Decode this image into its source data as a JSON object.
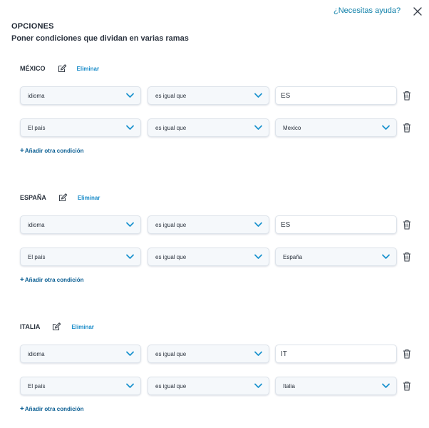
{
  "header": {
    "help_link": "¿Necesitas ayuda?",
    "title": "OPCIONES",
    "subtitle": "Poner condiciones que dividan en varias ramas"
  },
  "icons": {
    "close": "close-icon",
    "edit": "edit-icon",
    "trash": "trash-icon",
    "chevron": "chevron-down-icon"
  },
  "colors": {
    "accent_link": "#1a8cc9",
    "chevron": "#1c93cf",
    "add_condition": "#0b5f93"
  },
  "branches": [
    {
      "name": "MÉXICO",
      "delete_label": "Eliminar",
      "add_condition_label": "Añadir otra condición",
      "rows": [
        {
          "field": "idioma",
          "operator": "es igual que",
          "value": "ES"
        },
        {
          "field": "El país",
          "operator": "es igual que",
          "value": "Mexico"
        }
      ]
    },
    {
      "name": "ESPAÑA",
      "delete_label": "Eliminar",
      "add_condition_label": "Añadir otra condición",
      "rows": [
        {
          "field": "idioma",
          "operator": "es igual que",
          "value": "ES"
        },
        {
          "field": "El país",
          "operator": "es igual que",
          "value": "España"
        }
      ]
    },
    {
      "name": "ITALIA",
      "delete_label": "Eliminar",
      "add_condition_label": "Añadir otra condición",
      "rows": [
        {
          "field": "idioma",
          "operator": "es igual que",
          "value": "IT"
        },
        {
          "field": "El país",
          "operator": "es igual que",
          "value": "Italia"
        }
      ]
    }
  ]
}
